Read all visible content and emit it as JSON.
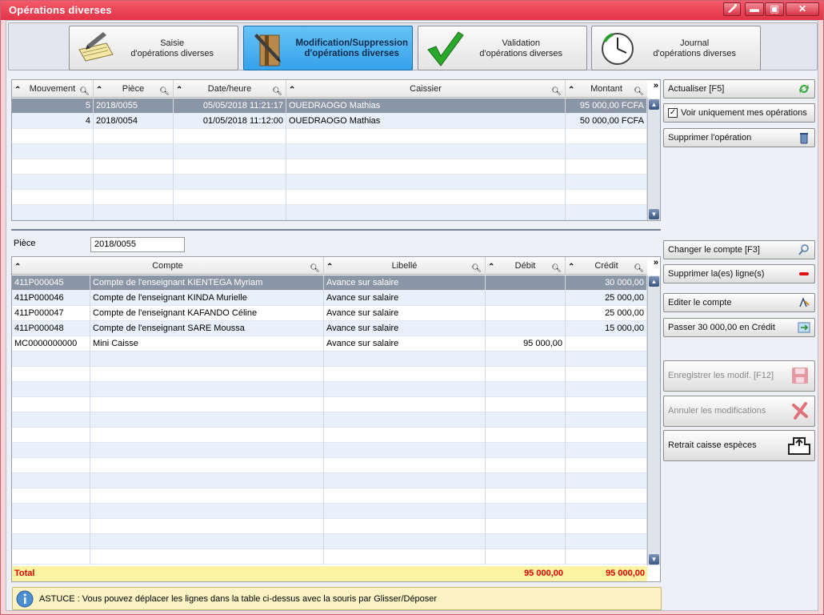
{
  "window": {
    "title": "Opérations diverses"
  },
  "tabs": [
    {
      "line1": "Saisie",
      "line2": "d'opérations diverses"
    },
    {
      "line1": "Modification/Suppression",
      "line2": "d'opérations diverses"
    },
    {
      "line1": "Validation",
      "line2": "d'opérations diverses"
    },
    {
      "line1": "Journal",
      "line2": "d'opérations diverses"
    }
  ],
  "ops_grid": {
    "headers": {
      "mouvement": "Mouvement",
      "piece": "Pièce",
      "datetime": "Date/heure",
      "caissier": "Caissier",
      "montant": "Montant"
    },
    "rows": [
      {
        "mouvement": "5",
        "piece": "2018/0055",
        "datetime": "05/05/2018 11:21:17",
        "caissier": "OUEDRAOGO Mathias",
        "montant": "95 000,00 FCFA"
      },
      {
        "mouvement": "4",
        "piece": "2018/0054",
        "datetime": "01/05/2018 11:12:00",
        "caissier": "OUEDRAOGO Mathias",
        "montant": "50 000,00 FCFA"
      }
    ]
  },
  "side_top": {
    "refresh": "Actualiser [F5]",
    "only_mine": "Voir uniquement mes opérations",
    "delete_op": "Supprimer l'opération"
  },
  "piece": {
    "label": "Pièce",
    "value": "2018/0055"
  },
  "lines_grid": {
    "headers": {
      "compte": "Compte",
      "libelle": "Libellé",
      "debit": "Débit",
      "credit": "Crédit"
    },
    "rows": [
      {
        "code": "411P000045",
        "compte": "Compte de l'enseignant KIENTEGA Myriam",
        "libelle": "Avance sur salaire",
        "debit": "",
        "credit": "30 000,00"
      },
      {
        "code": "411P000046",
        "compte": "Compte de l'enseignant KINDA Murielle",
        "libelle": "Avance sur salaire",
        "debit": "",
        "credit": "25 000,00"
      },
      {
        "code": "411P000047",
        "compte": "Compte de l'enseignant KAFANDO Céline",
        "libelle": "Avance sur salaire",
        "debit": "",
        "credit": "25 000,00"
      },
      {
        "code": "411P000048",
        "compte": "Compte de l'enseignant SARE Moussa",
        "libelle": "Avance sur salaire",
        "debit": "",
        "credit": "15 000,00"
      },
      {
        "code": "MC0000000000",
        "compte": "Mini Caisse",
        "libelle": "Avance sur salaire",
        "debit": "95 000,00",
        "credit": ""
      }
    ],
    "total": {
      "label": "Total",
      "debit": "95 000,00",
      "credit": "95 000,00"
    }
  },
  "side_bottom": {
    "change_account": "Changer le compte [F3]",
    "delete_lines": "Supprimer la(es) ligne(s)",
    "edit_account": "Editer le compte",
    "pass_credit": "Passer 30 000,00 en Crédit",
    "save": "Enregistrer les modif. [F12]",
    "cancel": "Annuler les modifications",
    "cash_withdraw": "Retrait caisse espèces"
  },
  "tip": {
    "text": "ASTUCE : Vous pouvez déplacer les lignes dans la table ci-dessus avec la souris par Glisser/Déposer"
  }
}
